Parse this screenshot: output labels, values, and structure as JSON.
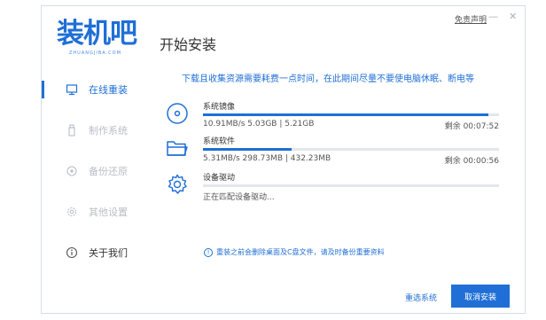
{
  "header": {
    "logo_text": "装机吧",
    "logo_sub": "ZHUANGJIBA.COM",
    "title": "开始安装",
    "disclaimer": "免责声明",
    "minimize_glyph": "—",
    "close_glyph": "✕"
  },
  "sidebar": {
    "items": [
      {
        "label": "在线重装",
        "icon": "monitor-icon",
        "state": "active"
      },
      {
        "label": "制作系统",
        "icon": "usb-icon",
        "state": "disabled"
      },
      {
        "label": "备份还原",
        "icon": "backup-icon",
        "state": "disabled"
      },
      {
        "label": "其他设置",
        "icon": "settings-icon",
        "state": "disabled"
      },
      {
        "label": "关于我们",
        "icon": "info-icon",
        "state": "normal"
      }
    ]
  },
  "main": {
    "notice": "下载且收集资源需要耗费一点时间，在此期间尽量不要使电脑休眠、断电等",
    "tasks": [
      {
        "name": "系统镜像",
        "icon": "disc-icon",
        "detail": "10.91MB/s 5.03GB | 5.21GB",
        "remaining": "剩余 00:07:52",
        "progress": 0.965
      },
      {
        "name": "系统软件",
        "icon": "folder-icon",
        "detail": "5.31MB/s 298.73MB | 432.23MB",
        "remaining": "剩余 00:00:56",
        "progress": 0.3
      },
      {
        "name": "设备驱动",
        "icon": "gear-icon",
        "detail": "正在匹配设备驱动...",
        "remaining": "",
        "progress": 0
      }
    ],
    "warning": "重装之前会删除桌面及C盘文件，请及时备份重要资料",
    "warning_icon": "!"
  },
  "footer": {
    "reselect_label": "重选系统",
    "cancel_label": "取消安装"
  },
  "colors": {
    "accent": "#1f6fd6",
    "track": "#e2e7ee"
  }
}
